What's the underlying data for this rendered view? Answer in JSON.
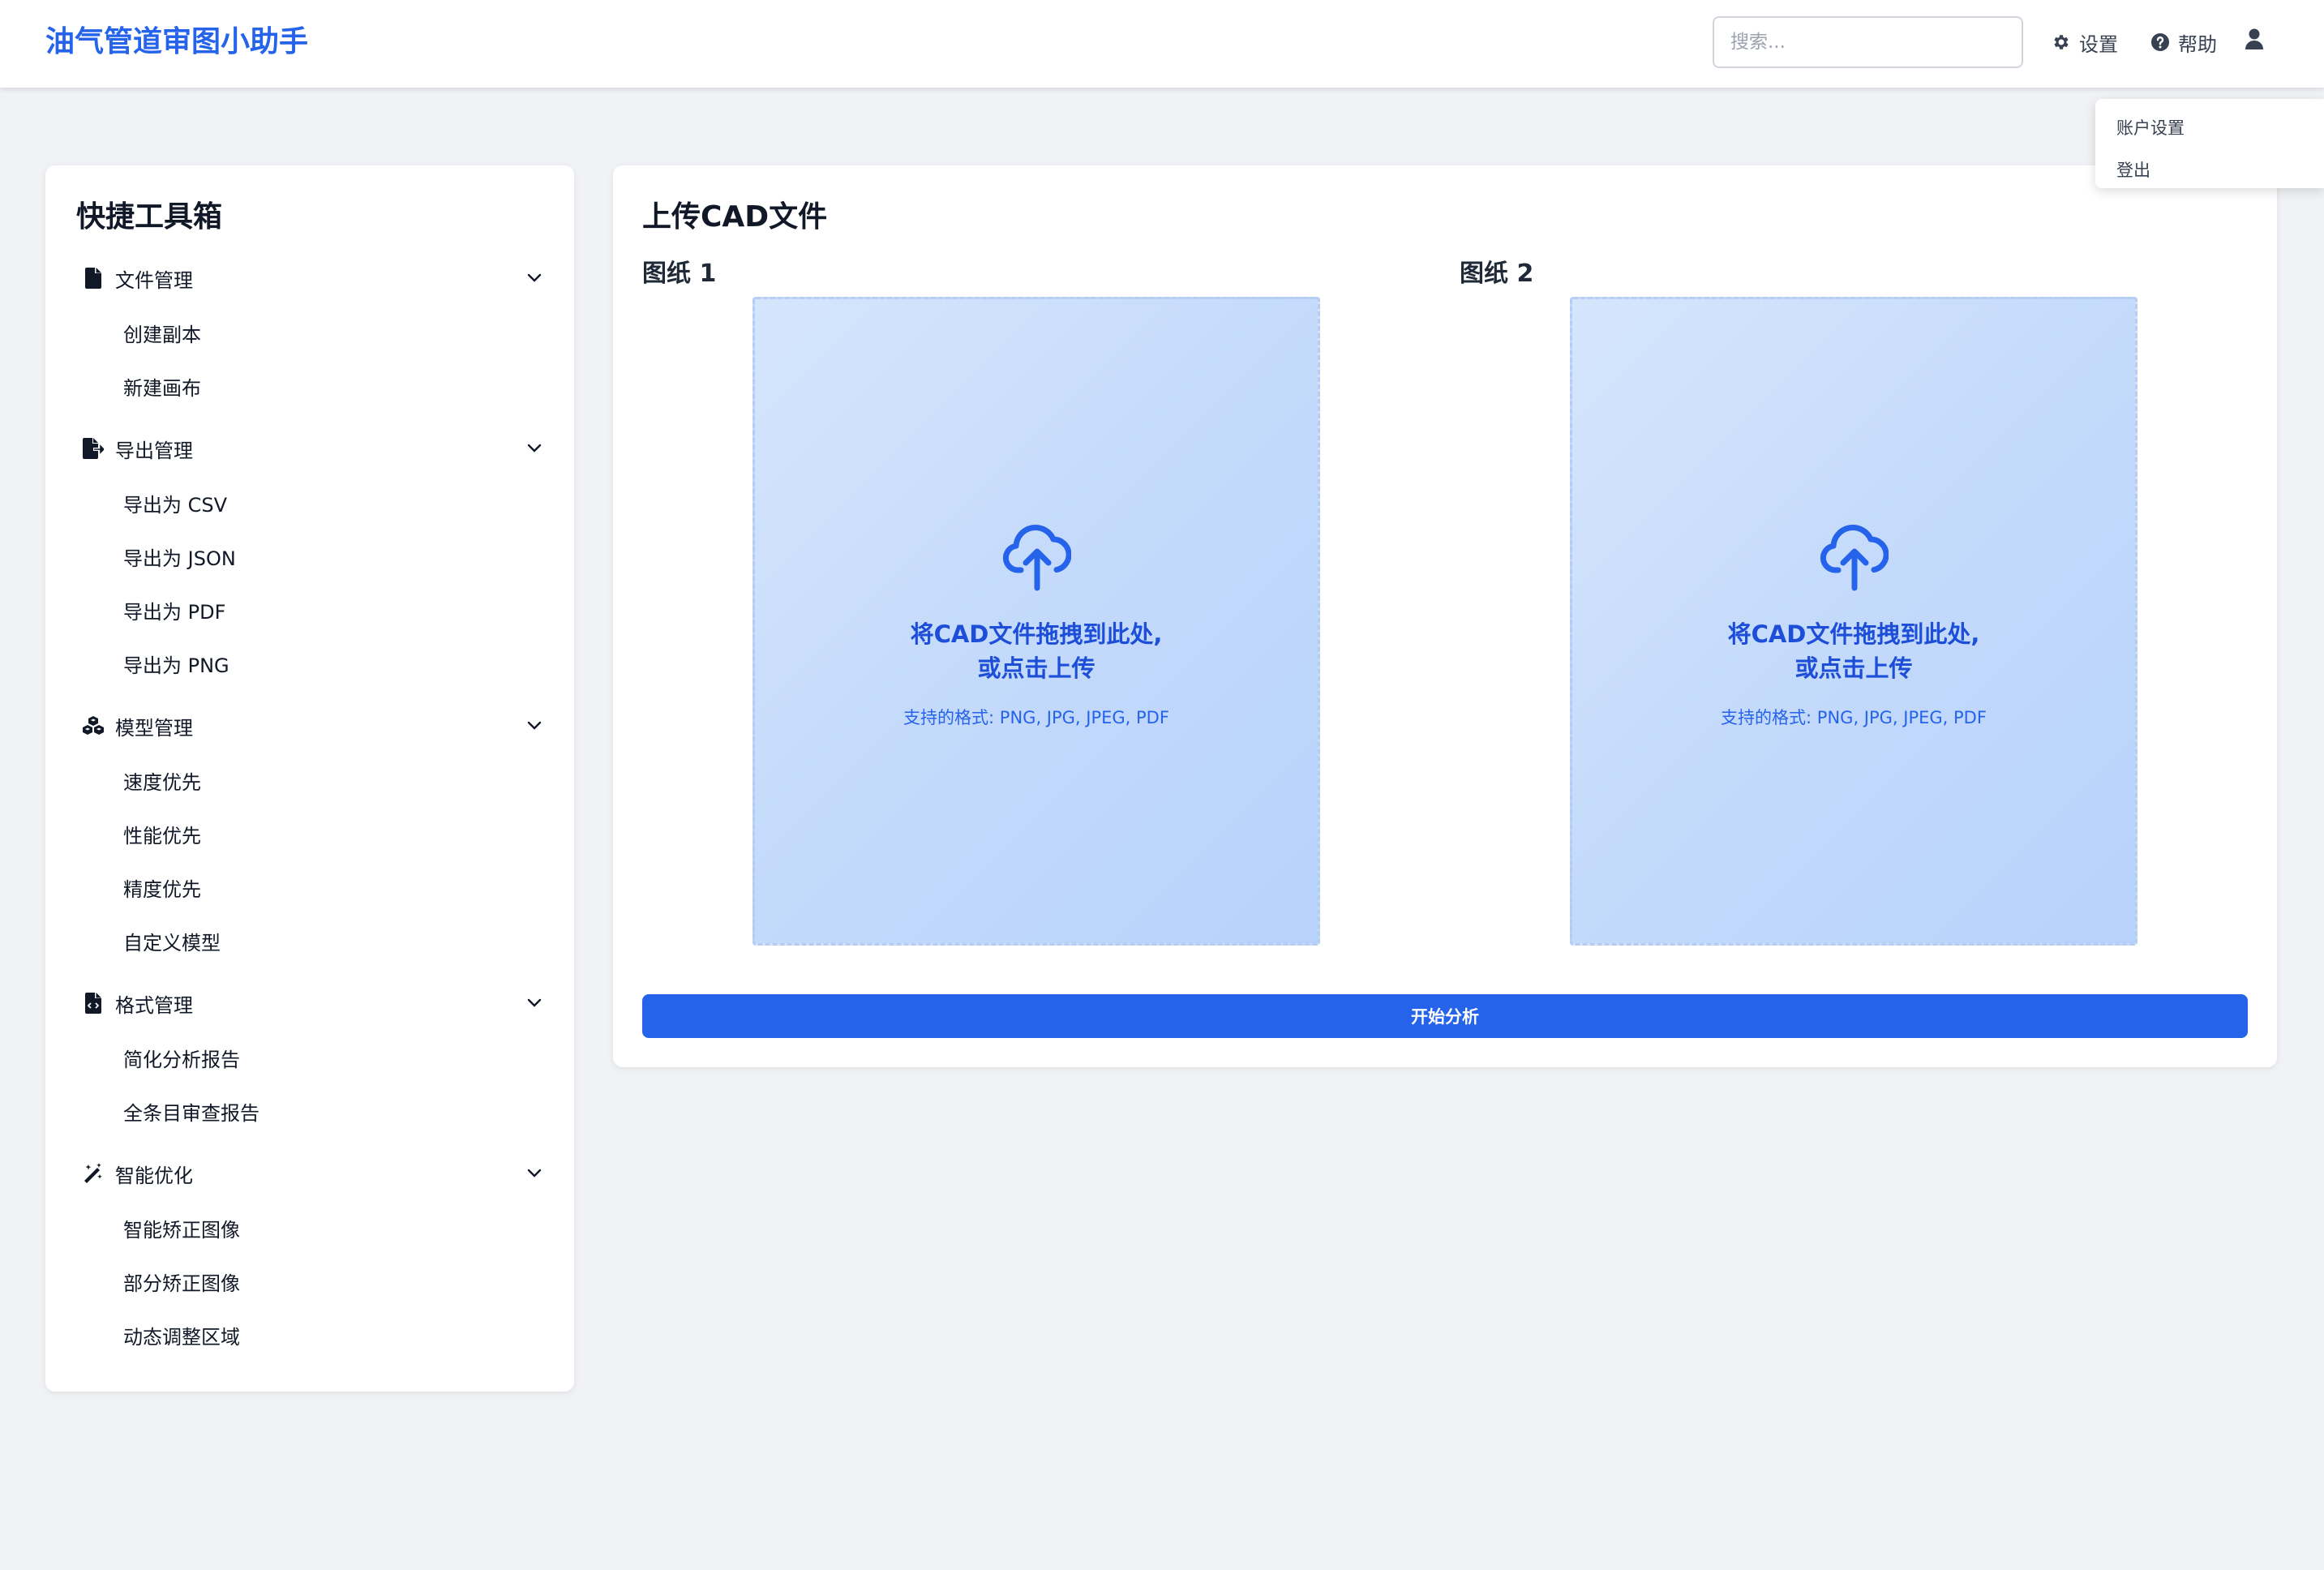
{
  "header": {
    "title": "油气管道审图小助手",
    "search_placeholder": "搜索...",
    "settings_label": "设置",
    "help_label": "帮助"
  },
  "user_menu": {
    "items": [
      "账户设置",
      "登出"
    ]
  },
  "sidebar": {
    "title": "快捷工具箱",
    "groups": [
      {
        "label": "文件管理",
        "icon": "file-icon",
        "items": [
          "创建副本",
          "新建画布"
        ]
      },
      {
        "label": "导出管理",
        "icon": "file-export-icon",
        "items": [
          "导出为 CSV",
          "导出为 JSON",
          "导出为 PDF",
          "导出为 PNG"
        ]
      },
      {
        "label": "模型管理",
        "icon": "cubes-icon",
        "items": [
          "速度优先",
          "性能优先",
          "精度优先",
          "自定义模型"
        ]
      },
      {
        "label": "格式管理",
        "icon": "file-code-icon",
        "items": [
          "简化分析报告",
          "全条目审查报告"
        ]
      },
      {
        "label": "智能优化",
        "icon": "magic-wand-icon",
        "items": [
          "智能矫正图像",
          "部分矫正图像",
          "动态调整区域"
        ]
      }
    ]
  },
  "main": {
    "title": "上传CAD文件",
    "drawings": [
      {
        "label": "图纸 1",
        "line1": "将CAD文件拖拽到此处,",
        "line2": "或点击上传",
        "formats": "支持的格式: PNG, JPG, JPEG, PDF"
      },
      {
        "label": "图纸 2",
        "line1": "将CAD文件拖拽到此处,",
        "line2": "或点击上传",
        "formats": "支持的格式: PNG, JPG, JPEG, PDF"
      }
    ],
    "analyze_label": "开始分析"
  },
  "colors": {
    "accent": "#2563eb",
    "dropzone_text": "#1d4ed8",
    "background": "#f0f2f5"
  }
}
